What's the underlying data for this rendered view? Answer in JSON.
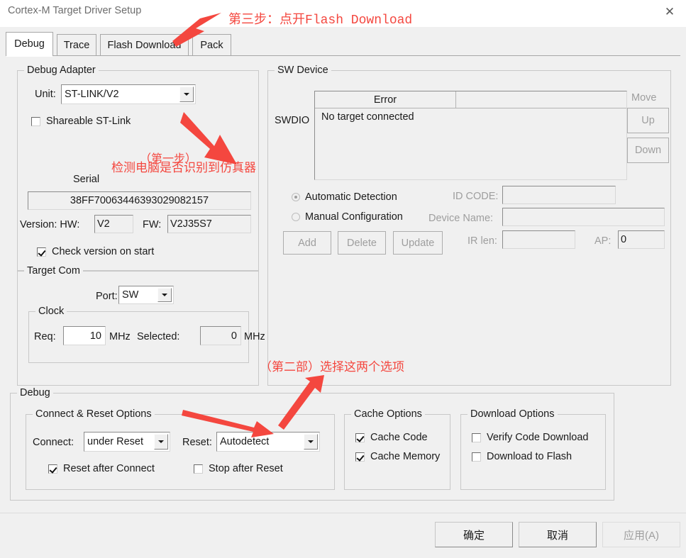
{
  "window": {
    "title": "Cortex-M Target Driver Setup",
    "close_icon": "close-icon"
  },
  "tabs": [
    {
      "label": "Debug",
      "active": true
    },
    {
      "label": "Trace",
      "active": false
    },
    {
      "label": "Flash Download",
      "active": false
    },
    {
      "label": "Pack",
      "active": false
    }
  ],
  "debug_adapter": {
    "group_label": "Debug Adapter",
    "unit_label": "Unit:",
    "unit_value": "ST-LINK/V2",
    "shareable_label": "Shareable ST-Link",
    "shareable_checked": false,
    "serial_label": "Serial",
    "serial_value": "38FF70063446393029082157",
    "version_label": "Version: HW:",
    "hw_value": "V2",
    "fw_label": "FW:",
    "fw_value": "V2J35S7",
    "check_version_label": "Check version on start",
    "check_version_checked": true
  },
  "target_com": {
    "group_label": "Target Com",
    "port_label": "Port:",
    "port_value": "SW",
    "clock_label": "Clock",
    "req_label": "Req:",
    "req_value": "10",
    "req_unit": "MHz",
    "selected_label": "Selected:",
    "selected_value": "0",
    "selected_unit": "MHz"
  },
  "sw_device": {
    "group_label": "SW Device",
    "swdio_label": "SWDIO",
    "columns": [
      "Error",
      ""
    ],
    "rows": [
      [
        "No target connected",
        ""
      ]
    ],
    "move_label": "Move",
    "up_label": "Up",
    "down_label": "Down",
    "automatic_detection_label": "Automatic Detection",
    "automatic_detection_selected": true,
    "manual_configuration_label": "Manual Configuration",
    "manual_configuration_selected": false,
    "id_code_label": "ID CODE:",
    "id_code_value": "",
    "device_name_label": "Device Name:",
    "device_name_value": "",
    "ir_len_label": "IR len:",
    "ir_len_value": "",
    "ap_label": "AP:",
    "ap_value": "0",
    "add_label": "Add",
    "delete_label": "Delete",
    "update_label": "Update"
  },
  "debug_section": {
    "group_label": "Debug",
    "connect_reset": {
      "group_label": "Connect & Reset Options",
      "connect_label": "Connect:",
      "connect_value": "under Reset",
      "reset_label": "Reset:",
      "reset_value": "Autodetect",
      "reset_after_connect_label": "Reset after Connect",
      "reset_after_connect_checked": true,
      "stop_after_reset_label": "Stop after Reset",
      "stop_after_reset_checked": false
    },
    "cache_options": {
      "group_label": "Cache Options",
      "cache_code_label": "Cache Code",
      "cache_code_checked": true,
      "cache_memory_label": "Cache Memory",
      "cache_memory_checked": true
    },
    "download_options": {
      "group_label": "Download Options",
      "verify_code_download_label": "Verify Code Download",
      "verify_code_download_checked": false,
      "download_to_flash_label": "Download to Flash",
      "download_to_flash_checked": false
    }
  },
  "footer": {
    "ok_label": "确定",
    "cancel_label": "取消",
    "apply_label": "应用(A)"
  },
  "annotations": {
    "step3": "第三步：点开Flash Download",
    "step1_line1": "（第一步）",
    "step1_line2": "检测电脑是否识别到仿真器",
    "step2": "（第二部）选择这两个选项",
    "color": "#f4473f"
  }
}
